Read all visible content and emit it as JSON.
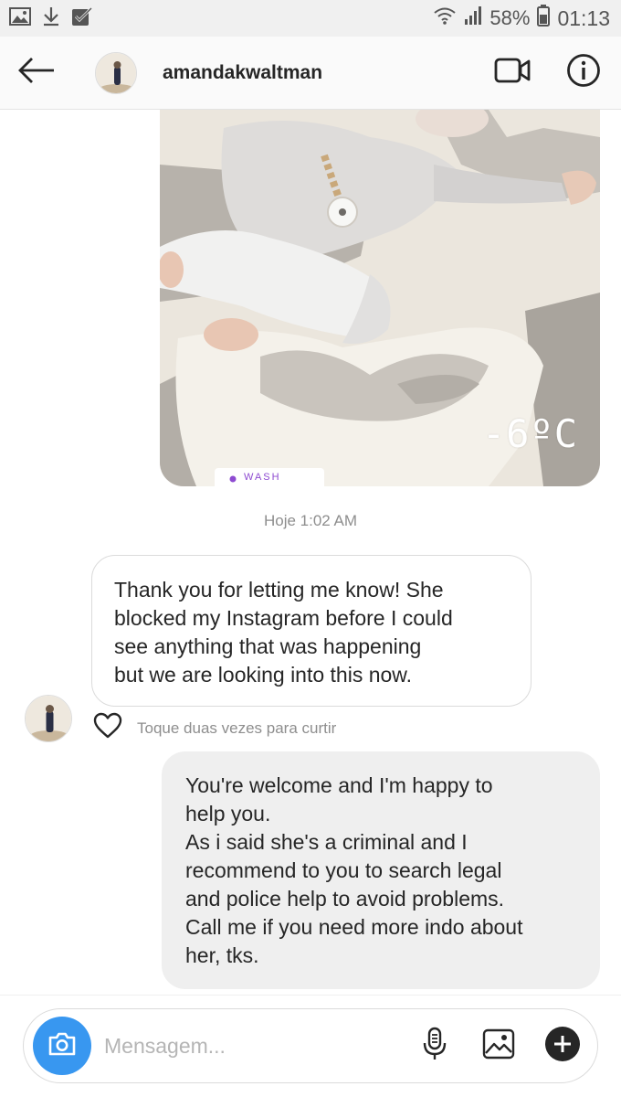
{
  "status_bar": {
    "battery": "58%",
    "time": "01:13",
    "icons": [
      "image-icon",
      "download-icon",
      "checkbox-icon",
      "wifi-icon",
      "signal-icon",
      "battery-icon"
    ]
  },
  "header": {
    "username": "amandakwaltman",
    "icons": [
      "back-arrow-icon",
      "video-call-icon",
      "info-icon"
    ]
  },
  "photo_message": {
    "overlay_text": "-6ºC",
    "location_sticker": "WASH"
  },
  "timestamp": "Hoje 1:02 AM",
  "incoming_message": {
    "text": "Thank you for letting me know! She\nblocked my Instagram before I could\nsee anything that was happening\nbut we are looking into this now.",
    "like_hint": "Toque duas vezes para curtir"
  },
  "outgoing_message": {
    "text": "You're welcome and I'm happy to\nhelp you.\nAs i said she's a criminal and I\nrecommend to you to search legal\nand police help to avoid problems.\nCall me if you need more indo about\nher, tks."
  },
  "composer": {
    "placeholder": "Mensagem...",
    "icons": [
      "camera-icon",
      "microphone-icon",
      "gallery-icon",
      "plus-icon"
    ]
  },
  "colors": {
    "accent_blue": "#3897f0",
    "outgoing_bubble": "#efefef",
    "incoming_border": "#dbdbdb",
    "secondary_text": "#8e8e8e"
  }
}
